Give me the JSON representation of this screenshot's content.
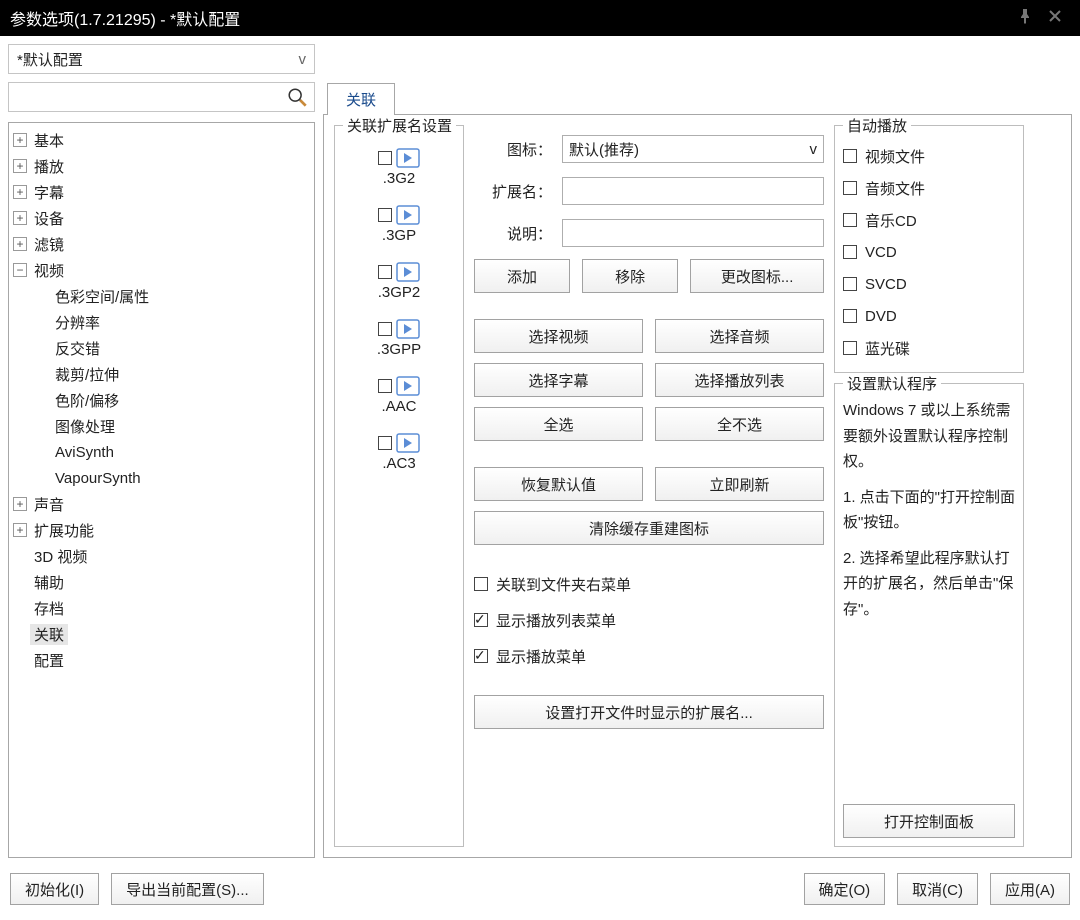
{
  "window": {
    "title": "参数选项(1.7.21295) - *默认配置"
  },
  "profile": {
    "selected": "*默认配置"
  },
  "search": {
    "placeholder": ""
  },
  "tree": [
    {
      "label": "基本",
      "expandable": true,
      "expanded": false
    },
    {
      "label": "播放",
      "expandable": true,
      "expanded": false
    },
    {
      "label": "字幕",
      "expandable": true,
      "expanded": false
    },
    {
      "label": "设备",
      "expandable": true,
      "expanded": false
    },
    {
      "label": "滤镜",
      "expandable": true,
      "expanded": false
    },
    {
      "label": "视频",
      "expandable": true,
      "expanded": true,
      "children": [
        {
          "label": "色彩空间/属性"
        },
        {
          "label": "分辨率"
        },
        {
          "label": "反交错"
        },
        {
          "label": "裁剪/拉伸"
        },
        {
          "label": "色阶/偏移"
        },
        {
          "label": "图像处理"
        },
        {
          "label": "AviSynth"
        },
        {
          "label": "VapourSynth"
        }
      ]
    },
    {
      "label": "声音",
      "expandable": true,
      "expanded": false
    },
    {
      "label": "扩展功能",
      "expandable": true,
      "expanded": false
    },
    {
      "label": "3D 视频",
      "expandable": false
    },
    {
      "label": "辅助",
      "expandable": false
    },
    {
      "label": "存档",
      "expandable": false
    },
    {
      "label": "关联",
      "expandable": false,
      "selected": true
    },
    {
      "label": "配置",
      "expandable": false
    }
  ],
  "tabs": [
    {
      "label": "关联",
      "active": true
    }
  ],
  "ext_group_title": "关联扩展名设置",
  "ext_items": [
    {
      "label": ".3G2"
    },
    {
      "label": ".3GP"
    },
    {
      "label": ".3GP2"
    },
    {
      "label": ".3GPP"
    },
    {
      "label": ".AAC"
    },
    {
      "label": ".AC3"
    }
  ],
  "fields": {
    "icon_label": "图标：",
    "icon_value": "默认(推荐)",
    "ext_label": "扩展名：",
    "ext_value": "",
    "desc_label": "说明：",
    "desc_value": ""
  },
  "buttons": {
    "add": "添加",
    "remove": "移除",
    "change_icon": "更改图标...",
    "sel_video": "选择视频",
    "sel_audio": "选择音频",
    "sel_sub": "选择字幕",
    "sel_playlist": "选择播放列表",
    "sel_all": "全选",
    "sel_none": "全不选",
    "restore": "恢复默认值",
    "refresh": "立即刷新",
    "clear_cache": "清除缓存重建图标",
    "set_open_ext": "设置打开文件时显示的扩展名...",
    "open_cp": "打开控制面板"
  },
  "mid_checks": {
    "assoc_context": {
      "label": "关联到文件夹右菜单",
      "checked": false
    },
    "show_playlist_menu": {
      "label": "显示播放列表菜单",
      "checked": true
    },
    "show_play_menu": {
      "label": "显示播放菜单",
      "checked": true
    }
  },
  "autoplay": {
    "title": "自动播放",
    "items": [
      {
        "label": "视频文件",
        "checked": false
      },
      {
        "label": "音频文件",
        "checked": false
      },
      {
        "label": "音乐CD",
        "checked": false
      },
      {
        "label": "VCD",
        "checked": false
      },
      {
        "label": "SVCD",
        "checked": false
      },
      {
        "label": "DVD",
        "checked": false
      },
      {
        "label": "蓝光碟",
        "checked": false
      }
    ]
  },
  "default_prog": {
    "title": "设置默认程序",
    "line1": "Windows 7 或以上系统需要额外设置默认程序控制权。",
    "line2": "1. 点击下面的\"打开控制面板\"按钮。",
    "line3": "2. 选择希望此程序默认打开的扩展名，然后单击\"保存\"。"
  },
  "footer": {
    "init": "初始化(I)",
    "export": "导出当前配置(S)...",
    "ok": "确定(O)",
    "cancel": "取消(C)",
    "apply": "应用(A)"
  }
}
